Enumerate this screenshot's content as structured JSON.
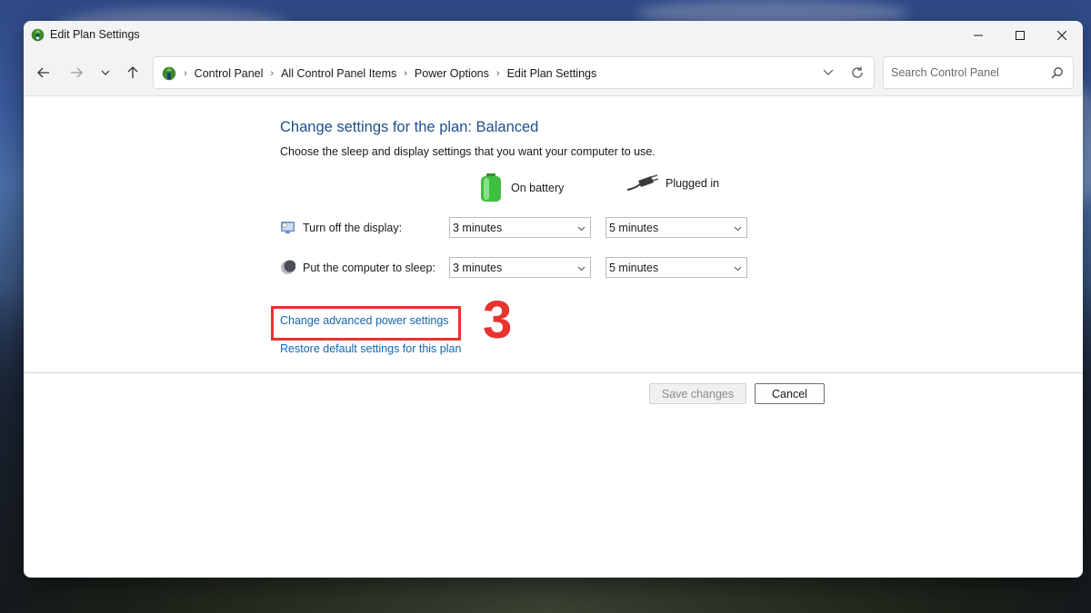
{
  "window": {
    "title": "Edit Plan Settings"
  },
  "navigation": {
    "breadcrumbs": [
      "Control Panel",
      "All Control Panel Items",
      "Power Options",
      "Edit Plan Settings"
    ],
    "search_placeholder": "Search Control Panel"
  },
  "main": {
    "heading": "Change settings for the plan: Balanced",
    "subheading": "Choose the sleep and display settings that you want your computer to use.",
    "columns": {
      "battery": "On battery",
      "plugged": "Plugged in"
    },
    "rows": {
      "display": {
        "label": "Turn off the display:",
        "battery_value": "3 minutes",
        "plugged_value": "5 minutes"
      },
      "sleep": {
        "label": "Put the computer to sleep:",
        "battery_value": "3 minutes",
        "plugged_value": "5 minutes"
      }
    },
    "links": {
      "advanced": "Change advanced power settings",
      "restore": "Restore default settings for this plan"
    },
    "annotation_number": "3",
    "buttons": {
      "save": "Save changes",
      "cancel": "Cancel"
    }
  },
  "colors": {
    "heading": "#1e4e8c",
    "link": "#1066b0",
    "annotation": "#e8332f"
  },
  "icons": {
    "app": "power-plant-icon",
    "display": "display-icon",
    "sleep": "moon-icon",
    "battery": "battery-icon",
    "plugged": "plug-icon"
  }
}
